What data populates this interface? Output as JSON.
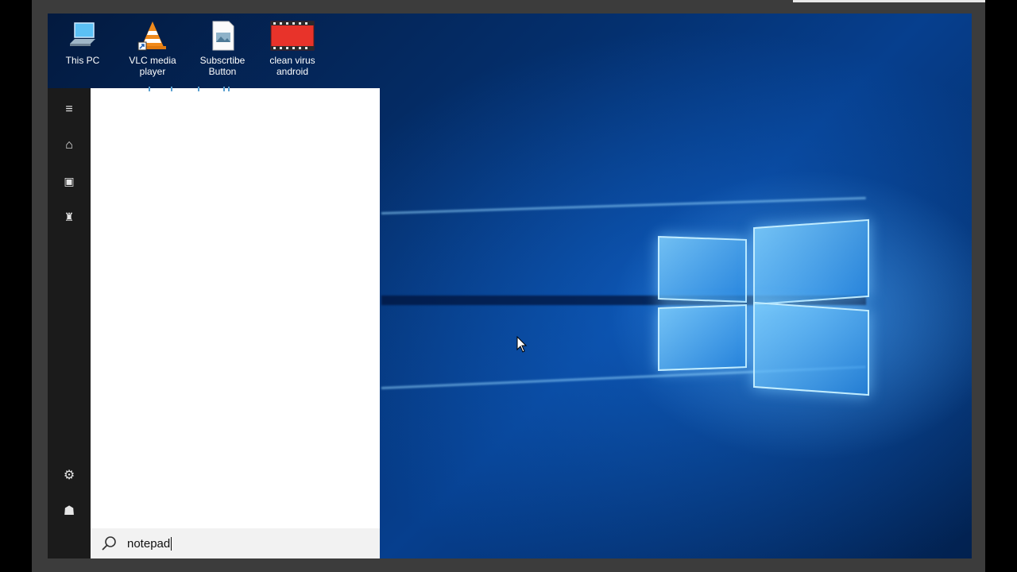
{
  "desktop_icons": [
    {
      "id": "this-pc",
      "label": "This PC",
      "icon": "computer-icon"
    },
    {
      "id": "vlc",
      "label": "VLC media\nplayer",
      "icon": "vlc-cone-icon"
    },
    {
      "id": "subscribe",
      "label": "Subscrtibe\nButton",
      "icon": "image-file-icon"
    },
    {
      "id": "clean-virus",
      "label": "clean virus\nandroid",
      "icon": "video-file-icon"
    }
  ],
  "start_rail": {
    "top": [
      {
        "name": "menu-icon",
        "glyph": "≡"
      },
      {
        "name": "home-icon",
        "glyph": "⌂"
      },
      {
        "name": "documents-icon",
        "glyph": "▣"
      },
      {
        "name": "tower-icon",
        "glyph": "♜"
      }
    ],
    "bottom": [
      {
        "name": "settings-gear-icon",
        "glyph": "⚙"
      },
      {
        "name": "feedback-icon",
        "glyph": "☗"
      }
    ]
  },
  "search": {
    "query": "notepad",
    "icon": "search-icon"
  },
  "colors": {
    "rail_bg": "#1b1b1b",
    "panel_bg": "#ffffff",
    "search_bg": "#f2f2f2",
    "wallpaper_accent": "#1e8fff"
  }
}
